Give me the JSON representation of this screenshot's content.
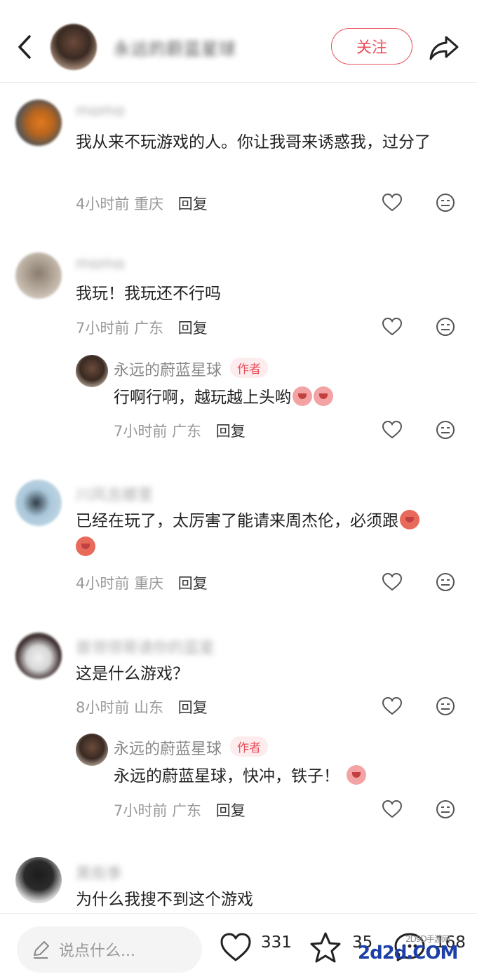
{
  "header": {
    "author_name": "永远的蔚蓝星球",
    "follow_label": "关注"
  },
  "comments": [
    {
      "username": "momo",
      "text": "我从来不玩游戏的人。你让我哥来诱惑我，过分了",
      "time": "4小时前",
      "location": "重庆",
      "reply_label": "回复"
    },
    {
      "username": "momo",
      "text": "我玩！我玩还不行吗",
      "time": "7小时前",
      "location": "广东",
      "reply_label": "回复",
      "reply": {
        "username": "永远的蔚蓝星球",
        "badge": "作者",
        "text": "行啊行啊，越玩越上头哟",
        "time": "7小时前",
        "location": "广东",
        "reply_label": "回复"
      }
    },
    {
      "username": "川风吉娜里",
      "text": "已经在玩了，太厉害了能请来周杰伦，必须跟",
      "time": "4小时前",
      "location": "重庆",
      "reply_label": "回复"
    },
    {
      "username": "首领领哥请你的蓝星",
      "text": "这是什么游戏？",
      "time": "8小时前",
      "location": "山东",
      "reply_label": "回复",
      "reply": {
        "username": "永远的蔚蓝星球",
        "badge": "作者",
        "text": "永远的蔚蓝星球，快冲，铁子！",
        "time": "7小时前",
        "location": "广东",
        "reply_label": "回复"
      }
    },
    {
      "username": "黑街季",
      "text": "为什么我搜不到这个游戏"
    }
  ],
  "bottom": {
    "input_placeholder": "说点什么...",
    "likes": "331",
    "stars": "35",
    "comments": "168"
  },
  "watermark": {
    "main": "2d2d.COM",
    "sub": "2D9D手游网"
  },
  "colors": {
    "accent": "#e8505b",
    "text": "#222222",
    "muted": "#999999"
  }
}
